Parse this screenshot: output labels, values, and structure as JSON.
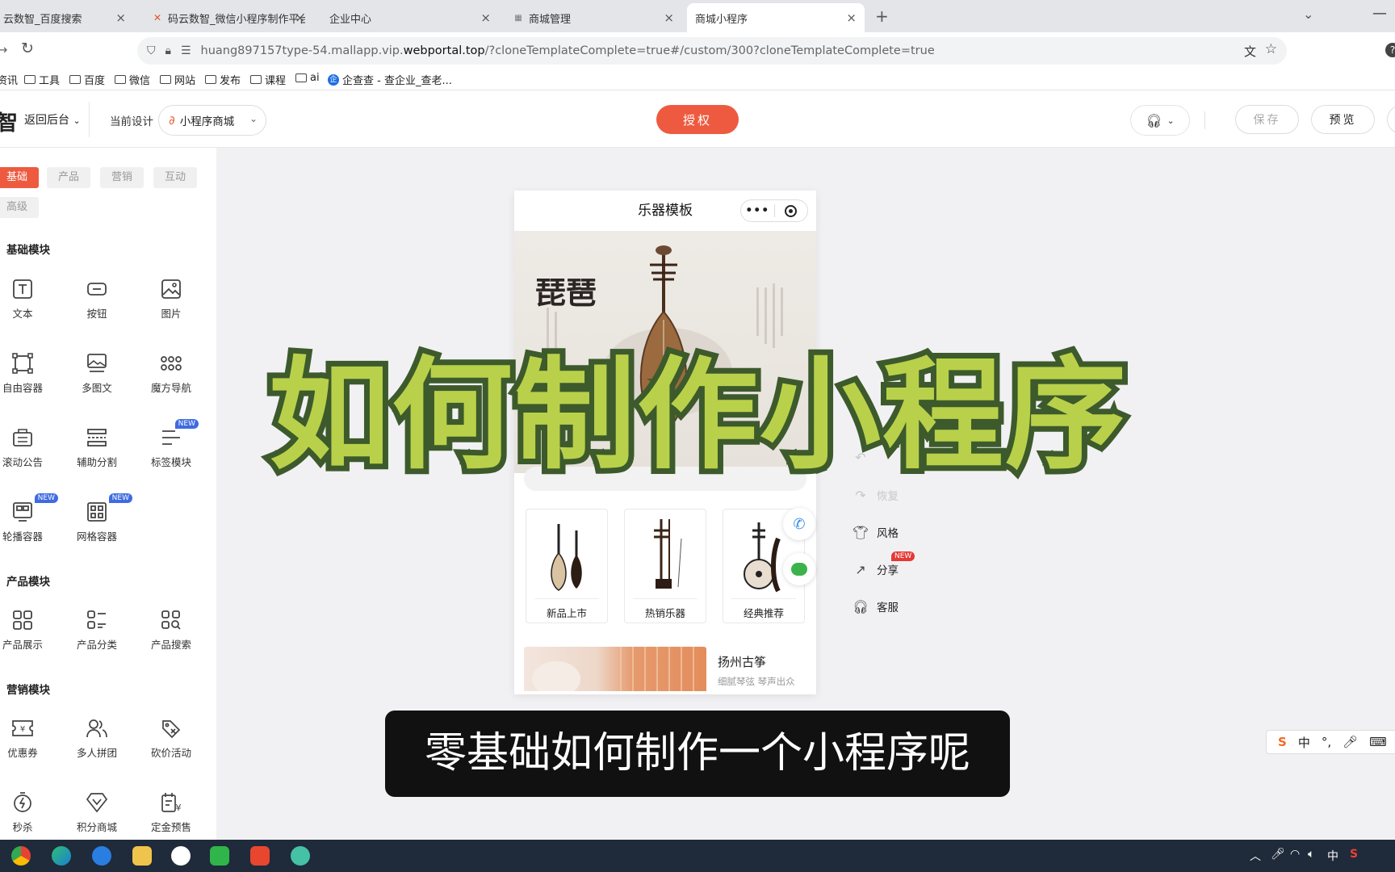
{
  "browser": {
    "tabs": [
      {
        "title": "云数智_百度搜索"
      },
      {
        "title": "码云数智_微信小程序制作平台_"
      },
      {
        "title": "企业中心"
      },
      {
        "title": "商城管理"
      },
      {
        "title": "商城小程序"
      }
    ],
    "url": {
      "prefix": "huang897157type-54.mallapp.vip.",
      "domain": "webportal.top",
      "suffix": "/?cloneTemplateComplete=true#/custom/300?cloneTemplateComplete=true"
    },
    "bookmarks": [
      "资讯",
      "工具",
      "百度",
      "微信",
      "网站",
      "发布",
      "课程",
      "ai",
      "企查查 - 查企业_查老..."
    ]
  },
  "header": {
    "brand": "智",
    "back_label": "返回后台",
    "current_design_label": "当前设计",
    "design_select_value": "小程序商城",
    "auth_label": "授权",
    "save_label": "保存",
    "preview_label": "预览"
  },
  "left_panel": {
    "categories": [
      "基础",
      "产品",
      "营销",
      "互动",
      "高级"
    ],
    "sections": [
      {
        "title": "基础模块",
        "items": [
          {
            "label": "文本",
            "icon": "text-icon"
          },
          {
            "label": "按钮",
            "icon": "button-icon"
          },
          {
            "label": "图片",
            "icon": "image-icon"
          },
          {
            "label": "自由容器",
            "icon": "free-container-icon"
          },
          {
            "label": "多图文",
            "icon": "multi-image-text-icon"
          },
          {
            "label": "魔方导航",
            "icon": "cube-nav-icon"
          },
          {
            "label": "滚动公告",
            "icon": "notice-icon"
          },
          {
            "label": "辅助分割",
            "icon": "divider-icon"
          },
          {
            "label": "标签模块",
            "icon": "tag-module-icon",
            "badge": "NEW"
          },
          {
            "label": "轮播容器",
            "icon": "carousel-icon",
            "badge": "NEW"
          },
          {
            "label": "网格容器",
            "icon": "grid-container-icon",
            "badge": "NEW"
          }
        ]
      },
      {
        "title": "产品模块",
        "items": [
          {
            "label": "产品展示",
            "icon": "product-display-icon"
          },
          {
            "label": "产品分类",
            "icon": "product-category-icon"
          },
          {
            "label": "产品搜索",
            "icon": "product-search-icon"
          }
        ]
      },
      {
        "title": "营销模块",
        "items": [
          {
            "label": "优惠券",
            "icon": "coupon-icon"
          },
          {
            "label": "多人拼团",
            "icon": "group-buy-icon"
          },
          {
            "label": "砍价活动",
            "icon": "bargain-icon"
          },
          {
            "label": "秒杀",
            "icon": "flash-sale-icon"
          },
          {
            "label": "积分商城",
            "icon": "points-mall-icon"
          },
          {
            "label": "定金预售",
            "icon": "deposit-presale-icon"
          }
        ]
      }
    ]
  },
  "phone": {
    "title": "乐器模板",
    "banner_text": "琵琶",
    "categories": [
      "新品上市",
      "热销乐器",
      "经典推荐"
    ],
    "product": {
      "title": "扬州古筝",
      "subtitle": "细腻琴弦 琴声出众"
    }
  },
  "side_actions": [
    {
      "label": "恢复",
      "disabled": true
    },
    {
      "label": "风格",
      "disabled": false
    },
    {
      "label": "分享",
      "badge": "NEW",
      "disabled": false
    },
    {
      "label": "客服",
      "disabled": false
    }
  ],
  "overlay": {
    "title": "如何制作小程序",
    "subtitle": "零基础如何制作一个小程序呢"
  },
  "ime": {
    "mode": "中"
  },
  "colors": {
    "accent": "#ee5a3f",
    "new_badge_blue": "#3f6be0",
    "overlay_text": "#b9d14a",
    "overlay_stroke": "#3d5a2c"
  }
}
